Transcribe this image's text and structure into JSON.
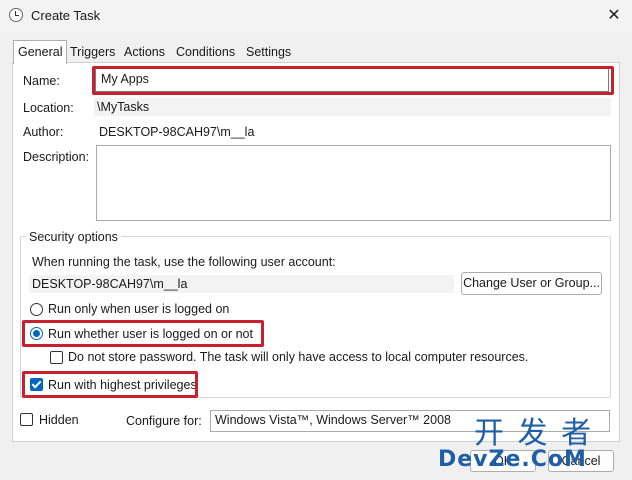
{
  "window": {
    "title": "Create Task",
    "close_glyph": "✕"
  },
  "tabs": [
    "General",
    "Triggers",
    "Actions",
    "Conditions",
    "Settings"
  ],
  "general": {
    "name_label": "Name:",
    "name_value": "My Apps",
    "location_label": "Location:",
    "location_value": "\\MyTasks",
    "author_label": "Author:",
    "author_value": "DESKTOP-98CAH97\\m__la",
    "description_label": "Description:",
    "description_value": ""
  },
  "security": {
    "title": "Security options",
    "account_prompt": "When running the task, use the following user account:",
    "account_value": "DESKTOP-98CAH97\\m__la",
    "change_button": "Change User or Group...",
    "radio_logged_on": "Run only when user is logged on",
    "radio_whether": "Run whether user is logged on or not",
    "do_not_store": "Do not store password.  The task will only have access to local computer resources.",
    "highest_privileges": "Run with highest privileges"
  },
  "footer": {
    "hidden_label": "Hidden",
    "configure_label": "Configure for:",
    "configure_value": "Windows Vista™, Windows Server™ 2008",
    "ok_label": "OK",
    "cancel_label": "Cancel"
  },
  "watermark": {
    "line1": "开 发 者",
    "line2": "DevZe.CoM"
  },
  "colors": {
    "highlight": "#c8202e",
    "accent": "#0067c0"
  }
}
